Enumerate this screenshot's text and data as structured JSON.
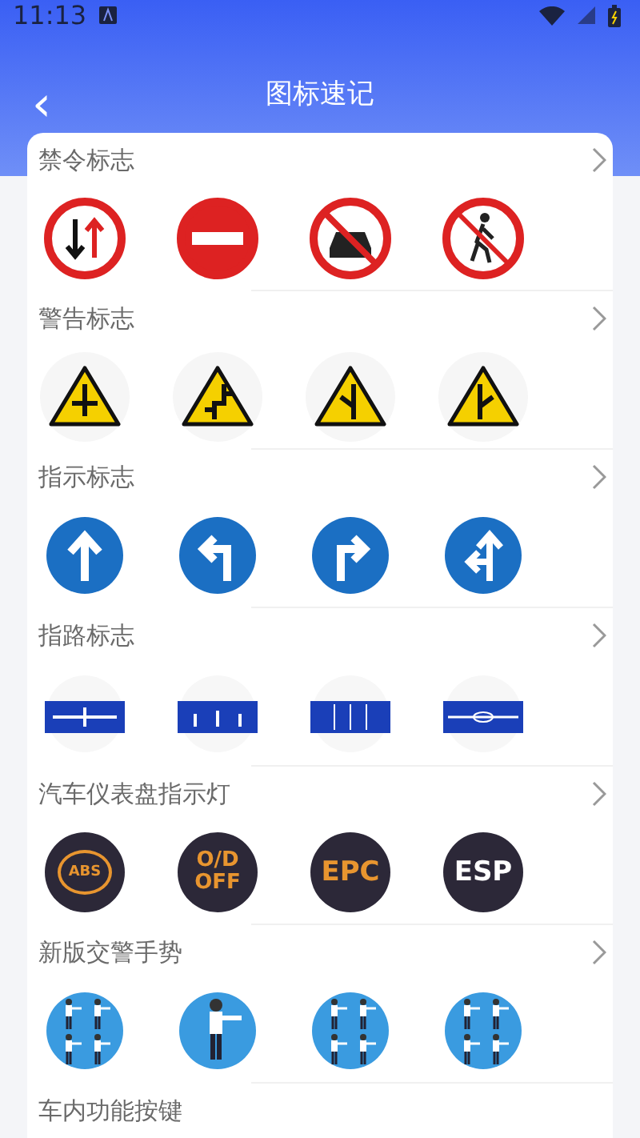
{
  "status_bar": {
    "time": "11:13"
  },
  "header": {
    "back": "‹",
    "title": "图标速记"
  },
  "sections": [
    {
      "kind": "prohibition",
      "title": "禁令标志",
      "items": [
        {
          "kind": "two-way"
        },
        {
          "kind": "no-entry"
        },
        {
          "kind": "no-cars"
        },
        {
          "kind": "no-pedestrians"
        }
      ]
    },
    {
      "kind": "warning",
      "title": "警告标志",
      "items": [
        {
          "kind": "crossroad"
        },
        {
          "kind": "staggered-left"
        },
        {
          "kind": "side-left"
        },
        {
          "kind": "side-right"
        }
      ]
    },
    {
      "kind": "mandatory",
      "title": "指示标志",
      "items": [
        {
          "kind": "straight"
        },
        {
          "kind": "left"
        },
        {
          "kind": "right"
        },
        {
          "kind": "straight-left"
        }
      ]
    },
    {
      "kind": "guide",
      "title": "指路标志",
      "items": [
        {
          "kind": "cross"
        },
        {
          "kind": "lanes"
        },
        {
          "kind": "split"
        },
        {
          "kind": "roundabout"
        }
      ]
    },
    {
      "kind": "dashboard",
      "title": "汽车仪表盘指示灯",
      "items": [
        {
          "kind": "ringed",
          "label": "ABS",
          "color": "#e8952f"
        },
        {
          "kind": "plain",
          "label": "O/D\nOFF",
          "color": "#e8952f"
        },
        {
          "kind": "plain",
          "label": "EPC",
          "color": "#e8952f"
        },
        {
          "kind": "plain",
          "label": "ESP",
          "color": "#ffffff"
        }
      ]
    },
    {
      "kind": "gesture",
      "title": "新版交警手势",
      "items": [
        {
          "kind": "four"
        },
        {
          "kind": "single"
        },
        {
          "kind": "four"
        },
        {
          "kind": "four"
        }
      ]
    },
    {
      "kind": "partial",
      "title": "车内功能按键"
    }
  ]
}
